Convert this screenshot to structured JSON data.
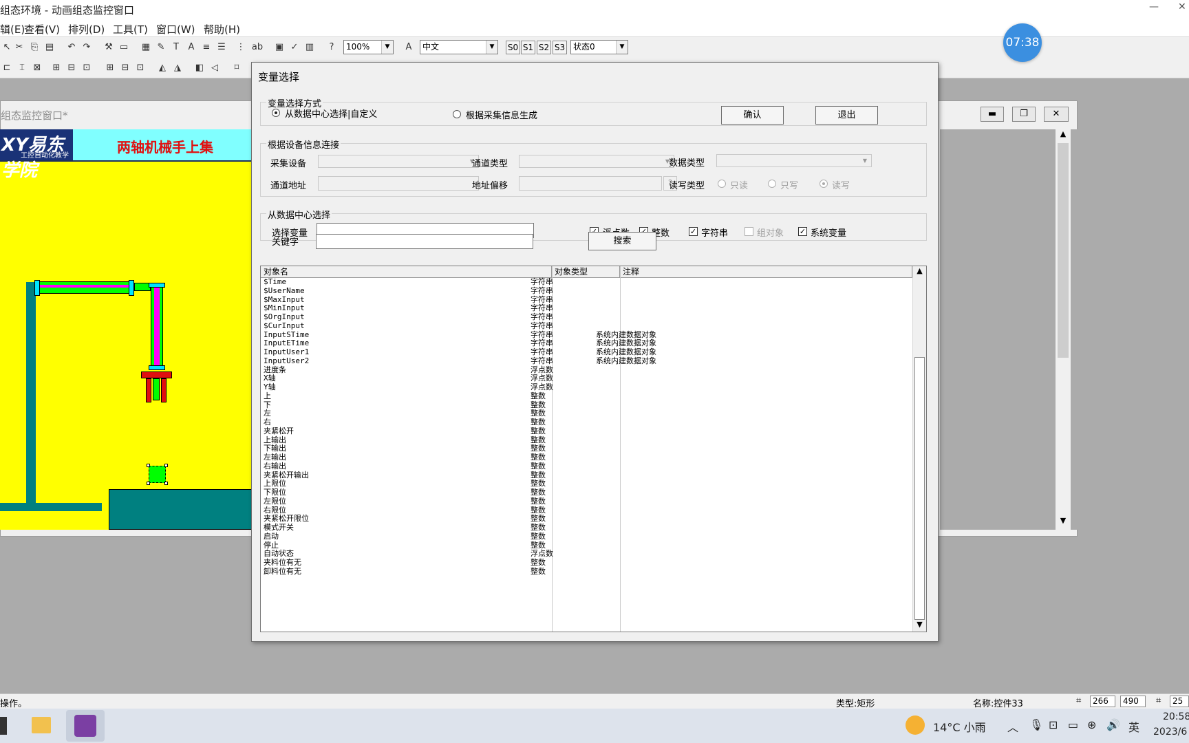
{
  "window": {
    "title": "组态环境 - 动画组态监控窗口",
    "minimize_glyph": "—",
    "close_glyph": "✕"
  },
  "menu": [
    "辑(E)",
    "查看(V)",
    "排列(D)",
    "工具(T)",
    "窗口(W)",
    "帮助(H)"
  ],
  "toolbar": {
    "zoom": "100%",
    "language": "中文",
    "states": [
      "S0",
      "S1",
      "S2",
      "S3"
    ],
    "state_select": "状态0"
  },
  "clock": "07:38",
  "mdi": {
    "caption": "组态监控窗口*",
    "logo_text": "XY易东学院",
    "logo_sub": "工控自动化教学",
    "banner_title": "两轴机械手上集"
  },
  "dialog": {
    "title": "变量选择",
    "mode_group": {
      "legend": "变量选择方式",
      "option_datacenter": "从数据中心选择|自定义",
      "option_collect": "根据采集信息生成",
      "confirm": "确认",
      "exit": "退出"
    },
    "device_group": {
      "legend": "根据设备信息连接",
      "collect_device": "采集设备",
      "channel_type": "通道类型",
      "data_type": "数据类型",
      "channel_addr": "通道地址",
      "addr_offset": "地址偏移",
      "offset_btn": "?",
      "rw_type": "读写类型",
      "rw_options": [
        "只读",
        "只写",
        "读写"
      ]
    },
    "center_group": {
      "legend": "从数据中心选择",
      "select_var": "选择变量",
      "filters": [
        {
          "label": "浮点数",
          "checked": true,
          "enabled": true
        },
        {
          "label": "整数",
          "checked": true,
          "enabled": true
        },
        {
          "label": "字符串",
          "checked": true,
          "enabled": true
        },
        {
          "label": "组对象",
          "checked": false,
          "enabled": false
        },
        {
          "label": "系统变量",
          "checked": true,
          "enabled": true
        }
      ]
    },
    "keyword": "关键字",
    "search": "搜索",
    "table": {
      "headers": [
        "对象名",
        "对象类型",
        "注释"
      ],
      "rows": [
        [
          "$Time",
          "字符串",
          ""
        ],
        [
          "$UserName",
          "字符串",
          ""
        ],
        [
          "$MaxInput",
          "字符串",
          ""
        ],
        [
          "$MinInput",
          "字符串",
          ""
        ],
        [
          "$OrgInput",
          "字符串",
          ""
        ],
        [
          "$CurInput",
          "字符串",
          ""
        ],
        [
          "InputSTime",
          "字符串",
          "系统内建数据对象"
        ],
        [
          "InputETime",
          "字符串",
          "系统内建数据对象"
        ],
        [
          "InputUser1",
          "字符串",
          "系统内建数据对象"
        ],
        [
          "InputUser2",
          "字符串",
          "系统内建数据对象"
        ],
        [
          "进度条",
          "浮点数",
          ""
        ],
        [
          "X轴",
          "浮点数",
          ""
        ],
        [
          "Y轴",
          "浮点数",
          ""
        ],
        [
          "上",
          "整数",
          ""
        ],
        [
          "下",
          "整数",
          ""
        ],
        [
          "左",
          "整数",
          ""
        ],
        [
          "右",
          "整数",
          ""
        ],
        [
          "夹紧松开",
          "整数",
          ""
        ],
        [
          "上输出",
          "整数",
          ""
        ],
        [
          "下输出",
          "整数",
          ""
        ],
        [
          "左输出",
          "整数",
          ""
        ],
        [
          "右输出",
          "整数",
          ""
        ],
        [
          "夹紧松开输出",
          "整数",
          ""
        ],
        [
          "上限位",
          "整数",
          ""
        ],
        [
          "下限位",
          "整数",
          ""
        ],
        [
          "左限位",
          "整数",
          ""
        ],
        [
          "右限位",
          "整数",
          ""
        ],
        [
          "夹紧松开限位",
          "整数",
          ""
        ],
        [
          "模式开关",
          "整数",
          ""
        ],
        [
          "启动",
          "整数",
          ""
        ],
        [
          "停止",
          "整数",
          ""
        ],
        [
          "自动状态",
          "浮点数",
          ""
        ],
        [
          "夹料位有无",
          "整数",
          ""
        ],
        [
          "卸料位有无",
          "整数",
          ""
        ]
      ]
    }
  },
  "statusbar": {
    "left": "操作。",
    "type": "类型:矩形",
    "name": "名称:控件33",
    "x": "266",
    "y": "490",
    "w": "25"
  },
  "taskbar": {
    "weather": "14°C 小雨",
    "ime": "英",
    "time": "20:58",
    "date": "2023/6"
  }
}
